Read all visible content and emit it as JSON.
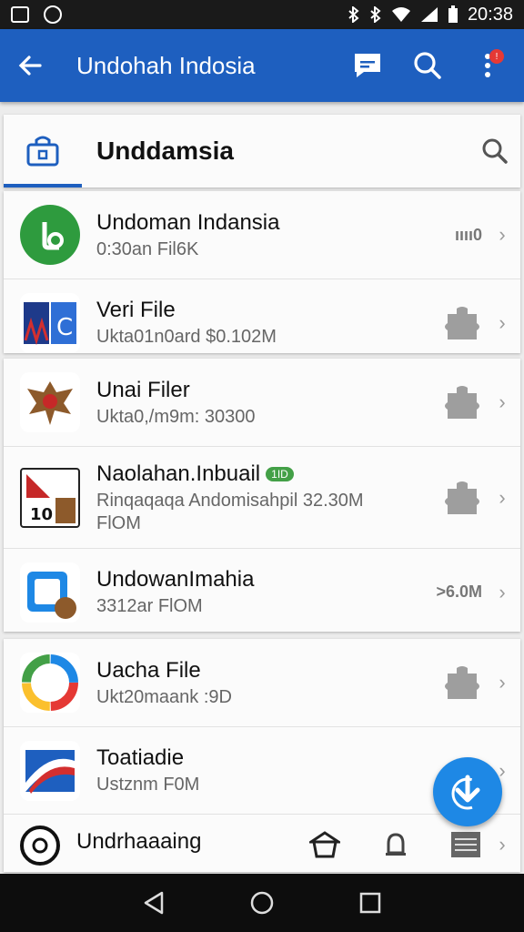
{
  "status_bar": {
    "time": "20:38"
  },
  "app_bar": {
    "title": "Undohah Indosia"
  },
  "notifications": {
    "badge": "!"
  },
  "header_card": {
    "title": "Unddamsia"
  },
  "list": [
    {
      "name": "Undoman Indansia",
      "sub": "0:30an Fil6K",
      "meta": "ıııı0"
    },
    {
      "name": "Veri File",
      "sub": "Ukta01n0ard $0.102M",
      "meta": ""
    },
    {
      "name": "Unai Filer",
      "sub": "Ukta0,/m9m: 30300",
      "meta": ""
    },
    {
      "name": "Naolahan.Inbuail",
      "badge": "1ID",
      "sub": "Rinqaqaqa Andomisahpil 32.30M",
      "sub2": "FlOM",
      "meta": ""
    },
    {
      "name": "UndowanImahia",
      "sub": "3312ar FlOM",
      "meta": ">6.0M"
    },
    {
      "name": "Uacha File",
      "sub": "Ukt20maank :9D",
      "meta": ""
    },
    {
      "name": "Toatiadie",
      "sub": "Ustznm F0M",
      "meta": ""
    },
    {
      "name": "Undrhaaaing",
      "sub": "",
      "meta": ""
    }
  ],
  "colors": {
    "primary": "#1e5fbf",
    "fab": "#1e88e5",
    "badge": "#43a047"
  }
}
